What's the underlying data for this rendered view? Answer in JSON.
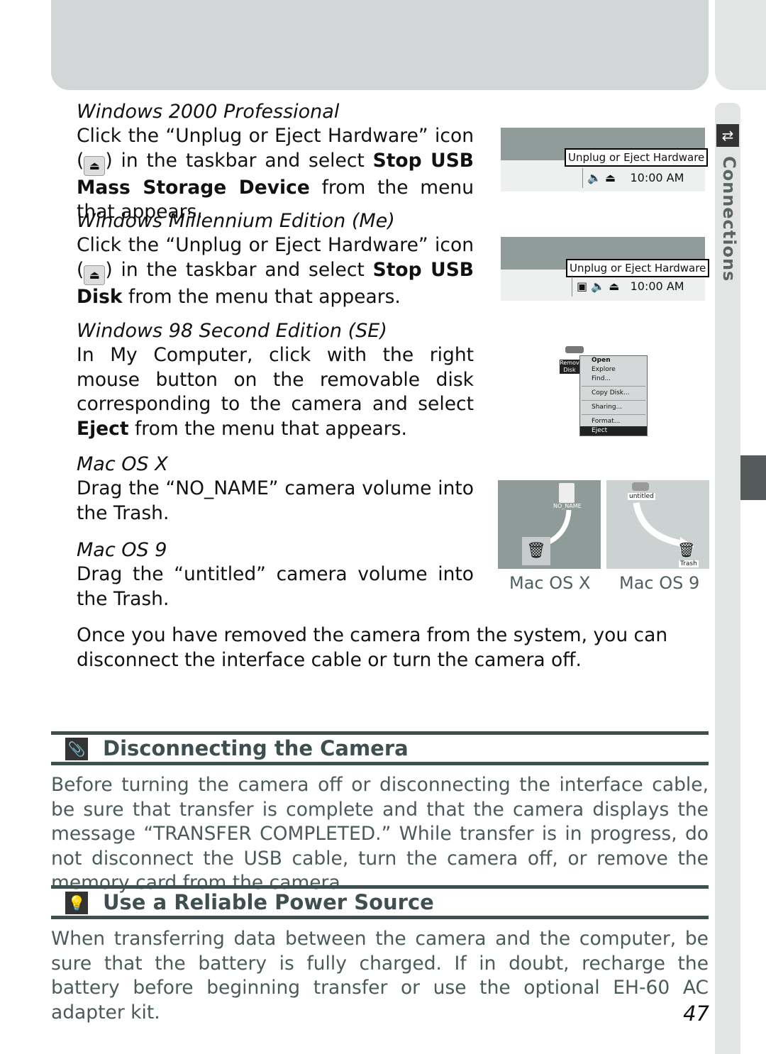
{
  "side_tab": {
    "label": "Connections",
    "icon": "connections-icon"
  },
  "sections": [
    {
      "title": "Windows 2000 Professional",
      "text_before": "Click the “Unplug or Eject Hardware” icon (",
      "text_mid": ") in the taskbar and select ",
      "bold": "Stop USB Mass Storage Device",
      "text_after": " from the menu that appears."
    },
    {
      "title": "Windows Millennium Edition (Me)",
      "text_before": "Click the “Unplug or Eject Hardware” icon (",
      "text_mid": ") in the taskbar and select ",
      "bold": "Stop USB Disk",
      "text_after": " from the menu that appears."
    },
    {
      "title": "Windows 98 Second Edition (SE)",
      "text_before": "In My Computer, click with the right mouse button on the removable disk corresponding to the camera and select ",
      "bold": "Eject",
      "text_after": " from the menu that appears."
    },
    {
      "title": "Mac OS X",
      "text": "Drag the “NO_NAME” camera volume into the Trash."
    },
    {
      "title": "Mac OS 9",
      "text": "Drag the “untitled” camera volume into the Trash."
    }
  ],
  "screens": {
    "win2000": {
      "tooltip": "Unplug or Eject Hardware",
      "clock": "10:00 AM"
    },
    "winme": {
      "tooltip": "Unplug or Eject Hardware",
      "clock": "10:00 AM"
    },
    "win98": {
      "disk_label": "Remov Disk",
      "menu": [
        "Open",
        "Explore",
        "Find...",
        "Copy Disk...",
        "Sharing...",
        "Format...",
        "Eject"
      ],
      "selected": "Eject"
    },
    "macx": {
      "volume": "NO_NAME",
      "caption": "Mac OS X"
    },
    "mac9": {
      "volume": "untitled",
      "trash": "Trash",
      "caption": "Mac OS 9"
    }
  },
  "closing_text": "Once you have removed the camera from the system, you can disconnect the interface cable or turn the camera off.",
  "notes": [
    {
      "title": "Disconnecting the Camera",
      "icon": "paperclip-icon",
      "text": "Before turning the camera off or disconnecting the interface cable, be sure that transfer is complete and that the camera displays the message “TRANSFER COMPLETED.”  While transfer is in progress, do not disconnect the USB cable, turn the camera off, or remove the memory card from the camera."
    },
    {
      "title": "Use a Reliable Power Source",
      "icon": "lightbulb-icon",
      "text": "When transferring data between the camera and the computer, be sure that the battery is fully charged.  If in doubt, recharge the battery before beginning transfer or use the optional EH-60 AC adapter kit."
    }
  ],
  "page_number": "47",
  "colors": {
    "accent": "#3f4f50",
    "note_text": "#4b5a5b",
    "panel": "#d3d6d6"
  }
}
